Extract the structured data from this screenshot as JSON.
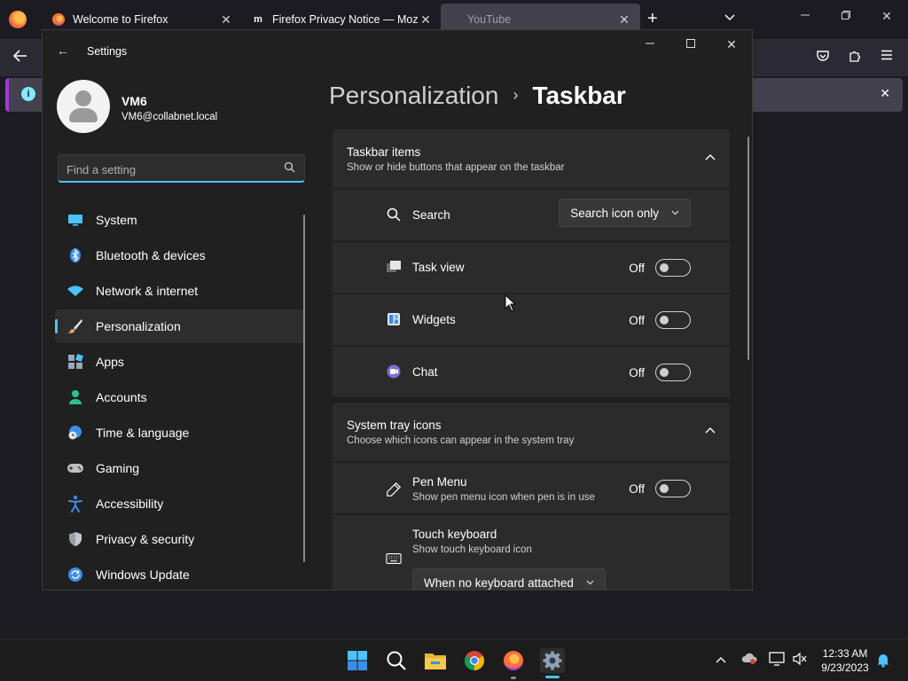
{
  "browser": {
    "tabs": [
      {
        "title": "Welcome to Firefox",
        "favicon": "firefox-icon"
      },
      {
        "title": "Firefox Privacy Notice — Mozilla",
        "favicon": "mozilla-m-icon",
        "favicon_text": "m"
      },
      {
        "title": "YouTube",
        "favicon": ""
      }
    ],
    "new_tab": "+",
    "close_glyph": "✕",
    "infobar_letter": "i"
  },
  "settings": {
    "window_title": "Settings",
    "back_glyph": "←",
    "profile": {
      "name": "VM6",
      "email": "VM6@collabnet.local"
    },
    "search": {
      "placeholder": "Find a setting"
    },
    "nav": [
      {
        "label": "System",
        "icon": "monitor-icon",
        "color": "#4cc2ff"
      },
      {
        "label": "Bluetooth & devices",
        "icon": "bluetooth-icon",
        "color": "#3b8eea"
      },
      {
        "label": "Network & internet",
        "icon": "wifi-icon",
        "color": "#4cc2ff"
      },
      {
        "label": "Personalization",
        "icon": "brush-icon",
        "color": "#e8a15a",
        "selected": true
      },
      {
        "label": "Apps",
        "icon": "apps-icon",
        "color": "#9aa8b8"
      },
      {
        "label": "Accounts",
        "icon": "person-icon",
        "color": "#2fbf8f"
      },
      {
        "label": "Time & language",
        "icon": "globe-clock-icon",
        "color": "#3b8eea"
      },
      {
        "label": "Gaming",
        "icon": "gamepad-icon",
        "color": "#c0c0c0"
      },
      {
        "label": "Accessibility",
        "icon": "accessibility-icon",
        "color": "#3b8eea"
      },
      {
        "label": "Privacy & security",
        "icon": "shield-icon",
        "color": "#9aa0a8"
      },
      {
        "label": "Windows Update",
        "icon": "update-icon",
        "color": "#3b8eea"
      }
    ],
    "breadcrumb": {
      "parent": "Personalization",
      "separator": "›",
      "current": "Taskbar"
    },
    "groups": {
      "taskbar_items": {
        "title": "Taskbar items",
        "subtitle": "Show or hide buttons that appear on the taskbar",
        "rows": [
          {
            "label": "Search",
            "icon": "search-icon",
            "dropdown": "Search icon only"
          },
          {
            "label": "Task view",
            "icon": "task-view-icon",
            "state": "Off"
          },
          {
            "label": "Widgets",
            "icon": "widgets-icon",
            "state": "Off"
          },
          {
            "label": "Chat",
            "icon": "chat-icon",
            "state": "Off"
          }
        ]
      },
      "system_tray": {
        "title": "System tray icons",
        "subtitle": "Choose which icons can appear in the system tray",
        "rows": [
          {
            "label": "Pen Menu",
            "sub": "Show pen menu icon when pen is in use",
            "icon": "pen-icon",
            "state": "Off"
          },
          {
            "label": "Touch keyboard",
            "sub": "Show touch keyboard icon",
            "icon": "keyboard-icon",
            "dropdown": "When no keyboard attached"
          }
        ]
      }
    }
  },
  "taskbar": {
    "apps": [
      "start-icon",
      "search-icon",
      "file-explorer-icon",
      "chrome-icon",
      "firefox-icon",
      "settings-gear-icon"
    ],
    "clock": {
      "time": "12:33 AM",
      "date": "9/23/2023"
    }
  },
  "colors": {
    "accent": "#4cc2ff",
    "firefox_purple": "#a33ad8"
  }
}
